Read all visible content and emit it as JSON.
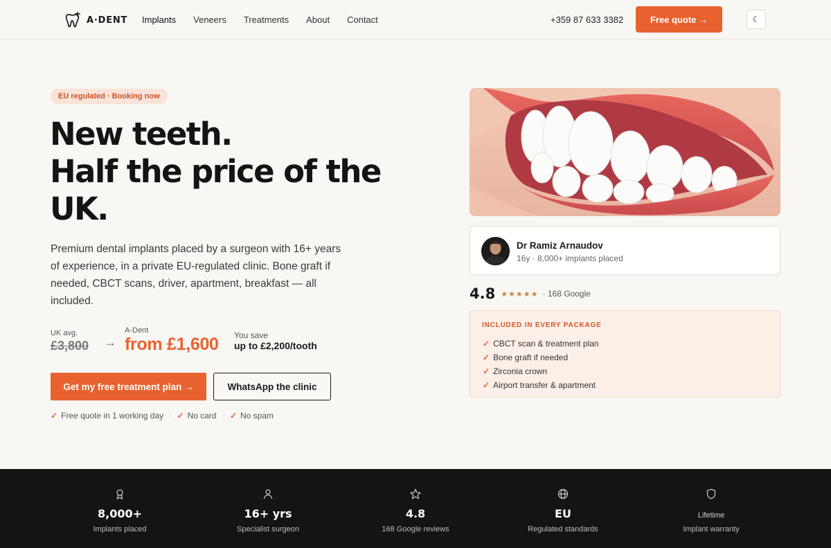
{
  "nav": {
    "brand": "A·DENT",
    "links": [
      "Implants",
      "Veneers",
      "Treatments",
      "About",
      "Contact"
    ],
    "phone": "+359 87 633 3382",
    "quote_label": "Free quote →",
    "theme_toggle": "☾"
  },
  "hero": {
    "badge": "EU regulated · Booking now",
    "headline": [
      "New teeth.",
      "Half the price of the",
      "UK."
    ],
    "intro": "Premium dental implants placed by a surgeon with 16+ years of experience, in a private EU-regulated clinic. Bone graft if needed, CBCT scans, driver, apartment, breakfast — all included.",
    "price": {
      "uk_label": "UK avg.",
      "uk_price": "£3,800",
      "arrow": "→",
      "adent_label": "A-Dent",
      "adent_price": "from £1,600",
      "save_label": "You save",
      "save_value": "up to £2,200/tooth"
    },
    "cta_primary": "Get my free treatment plan →",
    "cta_secondary": "WhatsApp the clinic",
    "assurances": [
      "Free quote in 1 working day",
      "No card",
      "No spam"
    ]
  },
  "doctor": {
    "name": "Dr Ramiz Arnaudov",
    "meta": "16y · 8,000+ implants placed"
  },
  "rating": {
    "score": "4.8",
    "stars": "★★★★★",
    "stars_value": 5,
    "source": "· 168 Google"
  },
  "included": {
    "title": "INCLUDED IN EVERY PACKAGE",
    "items": [
      "CBCT scan & treatment plan",
      "Bone graft if needed",
      "Zirconia crown",
      "Airport transfer & apartment"
    ]
  },
  "stats": [
    {
      "icon": "award-icon",
      "value": "8,000+",
      "label": "Implants placed"
    },
    {
      "icon": "user-icon",
      "value": "16+ yrs",
      "label": "Specialist surgeon"
    },
    {
      "icon": "star-icon",
      "value": "4.8",
      "label": "168 Google reviews"
    },
    {
      "icon": "globe-icon",
      "value": "EU",
      "label": "Regulated standards"
    },
    {
      "icon": "shield-icon",
      "value": "Lifetime",
      "label": "Implant warranty"
    }
  ],
  "colors": {
    "accent": "#e8622f",
    "background": "#f8f7f3",
    "stats_bg": "#141414",
    "badge_bg": "#f9e2d7",
    "included_bg": "#fbefe8"
  }
}
